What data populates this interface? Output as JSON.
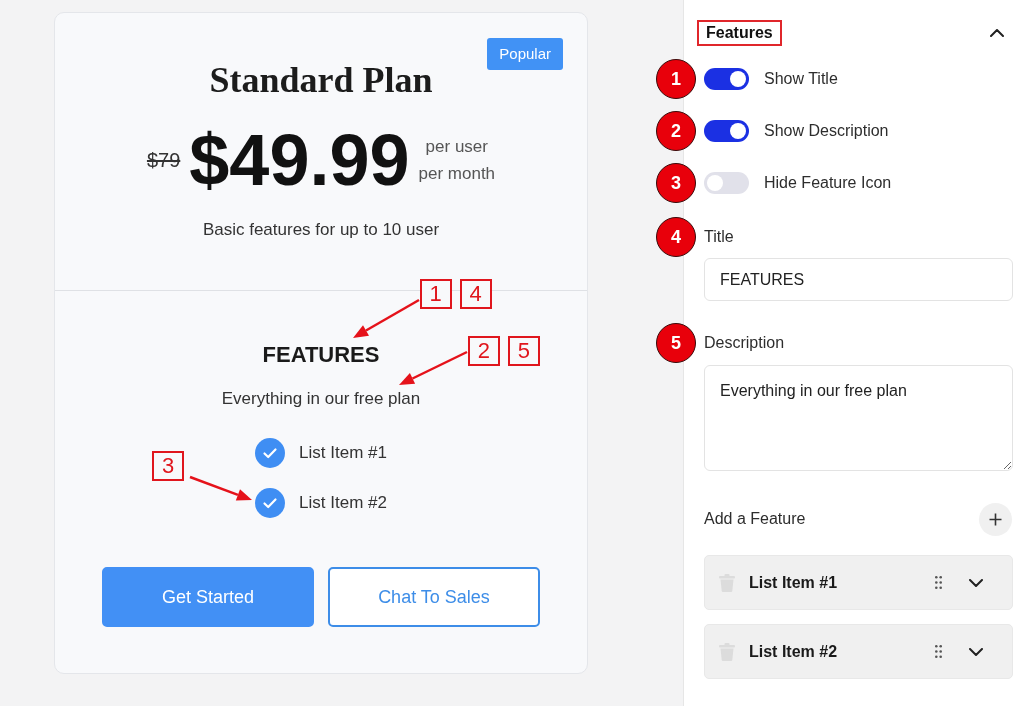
{
  "pricing_card": {
    "badge": "Popular",
    "title": "Standard Plan",
    "old_price": "$79",
    "price": "$49.99",
    "period_lines": [
      "per user",
      "per month"
    ],
    "summary": "Basic features for up to 10 user",
    "features_title": {
      "text": "FEATURES",
      "callouts": [
        "1",
        "4"
      ]
    },
    "features_description": {
      "text": "Everything in our free plan",
      "callouts": [
        "2",
        "5"
      ]
    },
    "features": [
      {
        "label": "List Item #1"
      },
      {
        "label": "List Item #2",
        "callouts": [
          "3"
        ]
      }
    ],
    "buttons": [
      {
        "label": "Get Started",
        "kind": "primary"
      },
      {
        "label": "Chat To Sales",
        "kind": "outline"
      }
    ]
  },
  "settings_panel": {
    "section": {
      "title": "Features",
      "highlighted": true,
      "expanded": true
    },
    "toggles": [
      {
        "label": "Show Title",
        "on": true,
        "marker": "1"
      },
      {
        "label": "Show Description",
        "on": true,
        "marker": "2"
      },
      {
        "label": "Hide Feature Icon",
        "on": false,
        "marker": "3"
      }
    ],
    "fields": [
      {
        "label": "Title",
        "kind": "text",
        "value": "FEATURES",
        "marker": "4"
      },
      {
        "label": "Description",
        "kind": "textarea",
        "value": "Everything in our free plan",
        "marker": "5"
      }
    ],
    "add_feature": {
      "label": "Add a Feature"
    },
    "feature_items": [
      {
        "label": "List Item #1",
        "expanded": false
      },
      {
        "label": "List Item #2",
        "expanded": false
      }
    ]
  }
}
